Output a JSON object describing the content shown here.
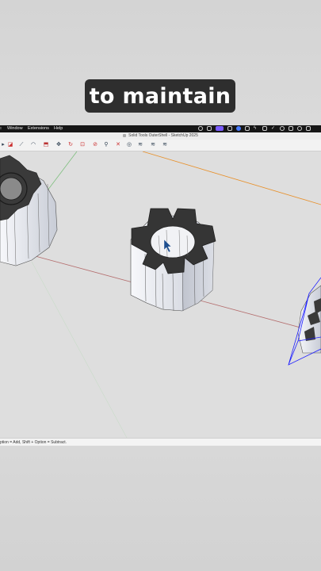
{
  "caption": {
    "text": "to maintain"
  },
  "menubar": {
    "items": [
      "Window",
      "Extensions",
      "Help"
    ]
  },
  "window": {
    "title": "Solid Tools OuterShell - SketchUp 2025"
  },
  "toolbar": {
    "tools": [
      "select-icon",
      "eraser-icon",
      "line-icon",
      "arc-icon",
      "push-pull-icon",
      "move-icon",
      "rotate-icon",
      "offset-icon",
      "tape-measure-icon",
      "orbit-icon",
      "pan-icon",
      "zoom-icon",
      "zoom-extents-icon",
      "outer-shell-icon",
      "intersect-icon",
      "union-icon",
      "subtract-icon"
    ]
  },
  "status": {
    "hint": "ption = Add, Shift + Option = Subtract."
  },
  "colors": {
    "accent": "#7b5cff",
    "selection": "#2020ff",
    "gear_top": "#3a3a3a",
    "axis_red": "#b46d6d",
    "axis_green": "#7fbf7f",
    "axis_orange": "#e8902a"
  }
}
